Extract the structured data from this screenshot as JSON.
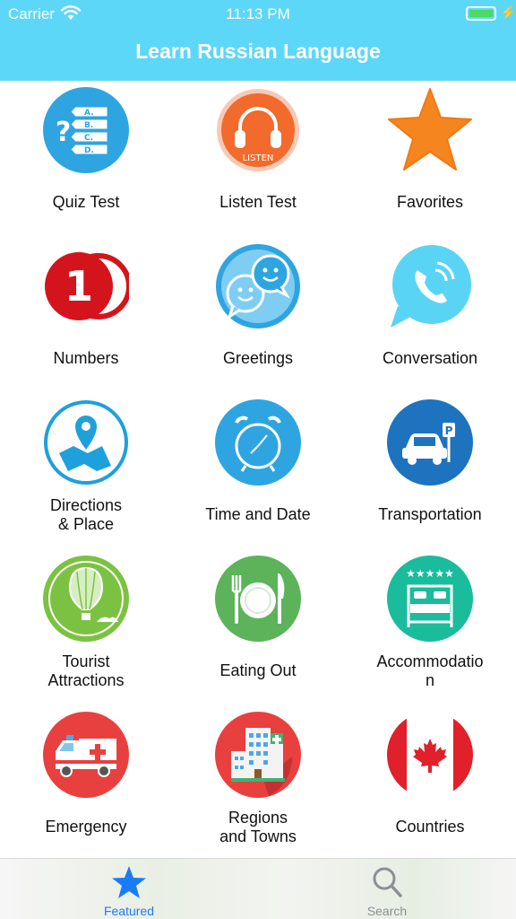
{
  "status_bar": {
    "carrier": "Carrier",
    "time": "11:13 PM",
    "battery_color": "#4cd964"
  },
  "header": {
    "title": "Learn Russian Language",
    "background": "#5dd7f8"
  },
  "menu": [
    {
      "label": "Quiz Test",
      "icon": "quiz-icon"
    },
    {
      "label": "Listen Test",
      "icon": "headphones-icon"
    },
    {
      "label": "Favorites",
      "icon": "star-icon"
    },
    {
      "label": "Numbers",
      "icon": "number-one-icon"
    },
    {
      "label": "Greetings",
      "icon": "smiley-chat-icon"
    },
    {
      "label": "Conversation",
      "icon": "phone-chat-icon"
    },
    {
      "label": "Directions\n& Place",
      "icon": "map-pin-icon"
    },
    {
      "label": "Time and Date",
      "icon": "alarm-clock-icon"
    },
    {
      "label": "Transportation",
      "icon": "car-parking-icon"
    },
    {
      "label": "Tourist\nAttractions",
      "icon": "hot-air-balloon-icon"
    },
    {
      "label": "Eating Out",
      "icon": "plate-cutlery-icon"
    },
    {
      "label": "Accommodatio\nn",
      "icon": "hotel-bed-icon"
    },
    {
      "label": "Emergency",
      "icon": "ambulance-icon"
    },
    {
      "label": "Regions\nand Towns",
      "icon": "hospital-building-icon"
    },
    {
      "label": "Countries",
      "icon": "canada-flag-icon"
    }
  ],
  "tab_bar": {
    "featured": {
      "label": "Featured",
      "icon": "star-icon",
      "active_color": "#1a7cf5"
    },
    "search": {
      "label": "Search",
      "icon": "search-icon",
      "color": "#8e8e93"
    }
  }
}
